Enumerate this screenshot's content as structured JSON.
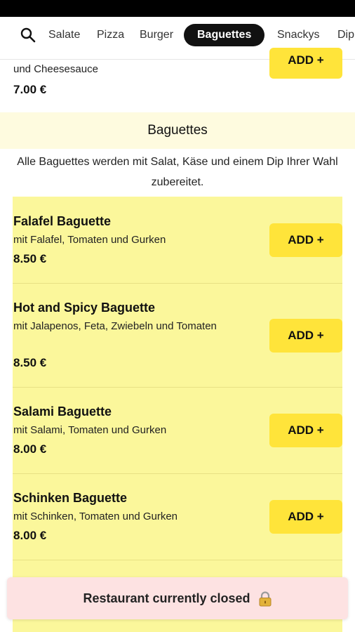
{
  "nav": {
    "search_icon": "search-icon",
    "tabs": [
      {
        "label": "Salate"
      },
      {
        "label": "Pizza"
      },
      {
        "label": "Burger"
      },
      {
        "label": "Baguettes",
        "active": true
      },
      {
        "label": "Snackys"
      },
      {
        "label": "Dip"
      }
    ]
  },
  "previous_item": {
    "desc": "und Cheesesauce",
    "price": "7.00 €",
    "add_label": "ADD +"
  },
  "section": {
    "title": "Baguettes",
    "description": "Alle Baguettes werden mit Salat, Käse und einem Dip Ihrer Wahl zubereitet."
  },
  "items": [
    {
      "name": "Falafel Baguette",
      "desc": "mit Falafel, Tomaten und Gurken",
      "price": "8.50 €",
      "add_label": "ADD +"
    },
    {
      "name": "Hot and Spicy Baguette",
      "desc": "mit Jalapenos, Feta, Zwiebeln und Tomaten",
      "price": "8.50 €",
      "add_label": "ADD +"
    },
    {
      "name": "Salami Baguette",
      "desc": "mit Salami, Tomaten und Gurken",
      "price": "8.00 €",
      "add_label": "ADD +"
    },
    {
      "name": "Schinken Baguette",
      "desc": "mit Schinken, Tomaten und Gurken",
      "price": "8.00 €",
      "add_label": "ADD +"
    }
  ],
  "banner": {
    "text": "Restaurant currently closed",
    "icon": "lock-icon"
  },
  "colors": {
    "accent_yellow": "#ffe43a",
    "list_background": "#fbf79b",
    "header_background": "#fefbdf",
    "banner_background": "#fde2e2",
    "active_tab": "#111111"
  }
}
